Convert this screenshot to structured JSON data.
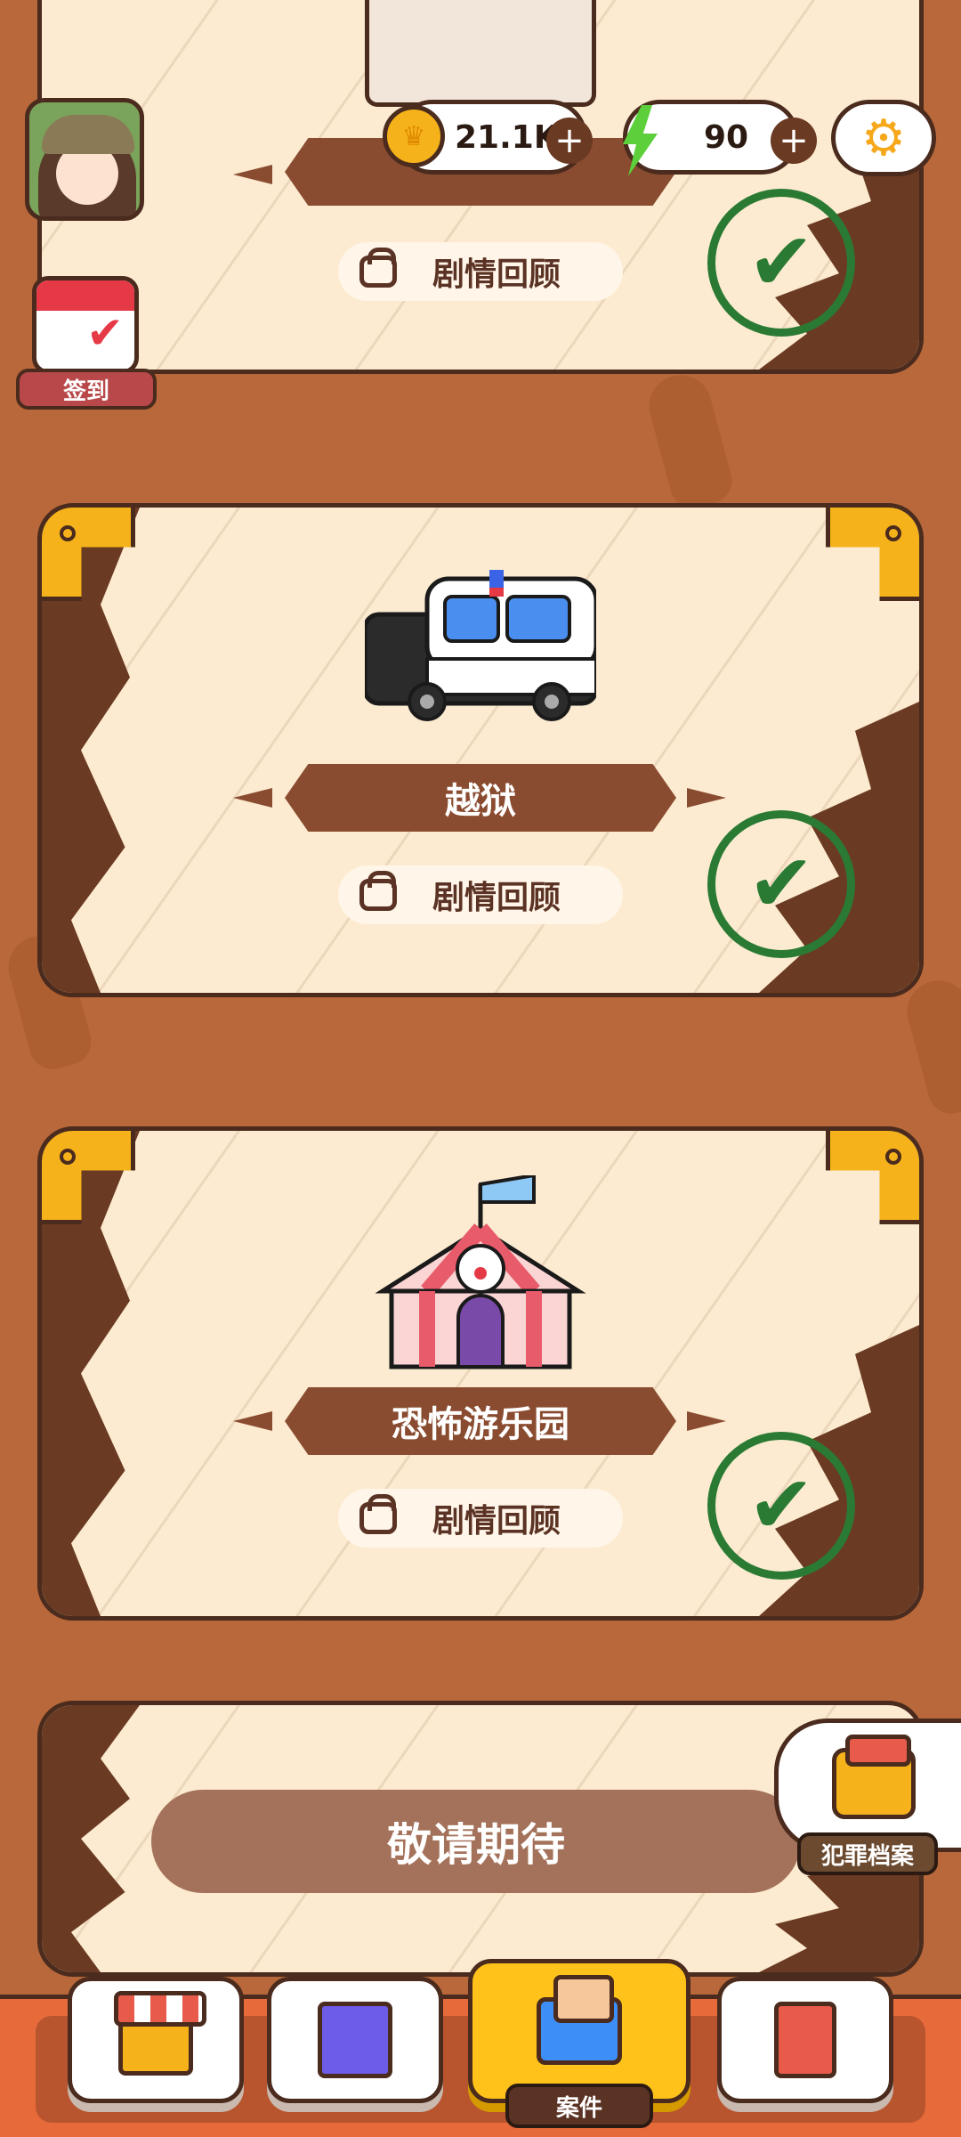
{
  "hud": {
    "coins": "21.1K",
    "energy": "90",
    "signin_label": "签到"
  },
  "cases": [
    {
      "title": "",
      "review_label": "剧情回顾",
      "completed": true,
      "icon": "book-icon"
    },
    {
      "title": "越狱",
      "review_label": "剧情回顾",
      "completed": true,
      "icon": "police-car-icon"
    },
    {
      "title": "恐怖游乐园",
      "review_label": "剧情回顾",
      "completed": true,
      "icon": "circus-tent-icon"
    }
  ],
  "coming_soon": "敬请期待",
  "side": {
    "crime_file_label": "犯罪档案"
  },
  "nav": {
    "items": [
      {
        "icon": "shop-icon",
        "label": ""
      },
      {
        "icon": "building-icon",
        "label": ""
      },
      {
        "icon": "mail-icon",
        "label": "案件",
        "active": true
      },
      {
        "icon": "book-icon",
        "label": ""
      }
    ]
  },
  "colors": {
    "accent": "#ffc21a",
    "check": "#2a7a34",
    "banner": "#8a4c30"
  }
}
